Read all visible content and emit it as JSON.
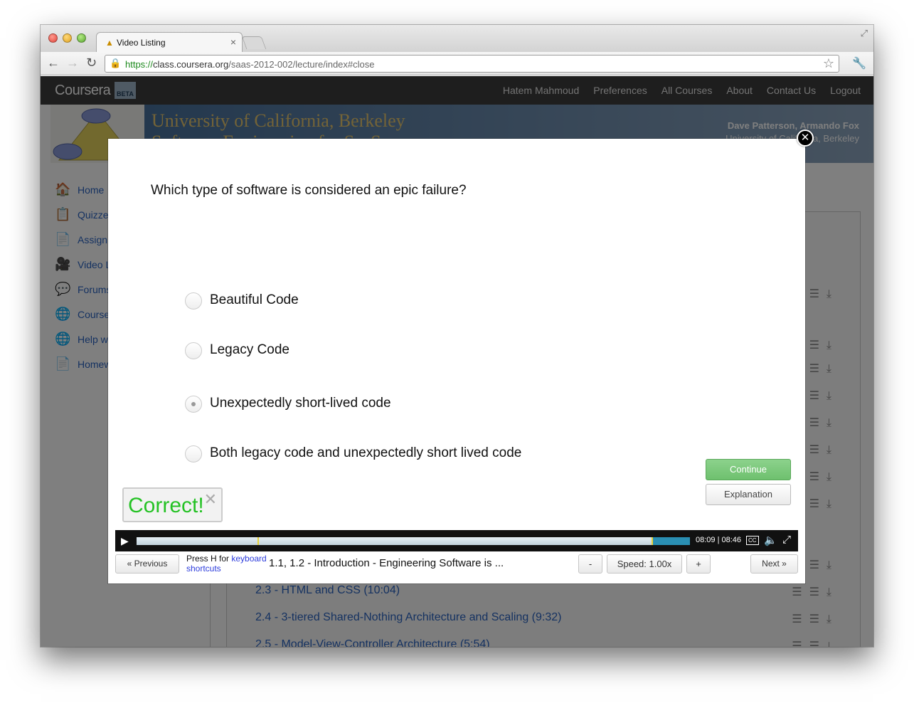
{
  "browser": {
    "tab_title": "Video Listing",
    "url_scheme": "https://",
    "url_host": "class.coursera.org",
    "url_path": "/saas-2012-002/lecture/index#close"
  },
  "site": {
    "logo": "Coursera",
    "beta": "BETA",
    "nav": [
      "Hatem Mahmoud",
      "Preferences",
      "All Courses",
      "About",
      "Contact Us",
      "Logout"
    ],
    "university": "University of California, Berkeley",
    "course": "Software Engineering for SaaS",
    "instructors": "Dave Patterson, Armando Fox",
    "instructor_org": "University of California, Berkeley"
  },
  "sidebar": {
    "items": [
      {
        "label": "Home",
        "icon": "house-icon"
      },
      {
        "label": "Quizzes",
        "icon": "quiz-icon"
      },
      {
        "label": "Assignments",
        "icon": "code-icon"
      },
      {
        "label": "Video Lectures",
        "icon": "video-camera-icon"
      },
      {
        "label": "Forums",
        "icon": "forum-icon"
      },
      {
        "label": "Course Info",
        "icon": "globe-icon"
      },
      {
        "label": "Help with Ruby",
        "icon": "globe-icon"
      },
      {
        "label": "Homework",
        "icon": "code-icon"
      }
    ]
  },
  "listing": {
    "rows": [
      "2.3 - HTML and CSS (10:04)",
      "2.4 - 3-tiered Shared-Nothing Architecture and Scaling (9:32)",
      "2.5 - Model-View-Controller Architecture (5:54)"
    ]
  },
  "quiz": {
    "question": "Which type of software is considered an epic failure?",
    "options": [
      {
        "label": "Beautiful Code",
        "selected": false
      },
      {
        "label": "Legacy Code",
        "selected": false
      },
      {
        "label": "Unexpectedly short-lived code",
        "selected": true
      },
      {
        "label": "Both legacy code and unexpectedly short lived code",
        "selected": false
      }
    ],
    "continue_label": "Continue",
    "explanation_label": "Explanation",
    "feedback": "Correct!",
    "close_glyph": "✕"
  },
  "player": {
    "current_time": "08:09",
    "duration": "08:46",
    "played_fraction": 0.93,
    "buffered_fraction": 1.0,
    "cc_label": "CC",
    "prev_label": "« Previous",
    "help_prefix": "Press H for ",
    "help_link1": "keyboard",
    "help_link2": "shortcuts",
    "lecture_title": "1.1, 1.2 - Introduction - Engineering Software is ...",
    "speed_minus": "-",
    "speed_label": "Speed: 1.00x",
    "speed_plus": "+",
    "next_label": "Next »"
  },
  "colors": {
    "accent_link": "#2b64c3",
    "correct_green": "#25c225",
    "continue_green": "#7cc97c"
  }
}
